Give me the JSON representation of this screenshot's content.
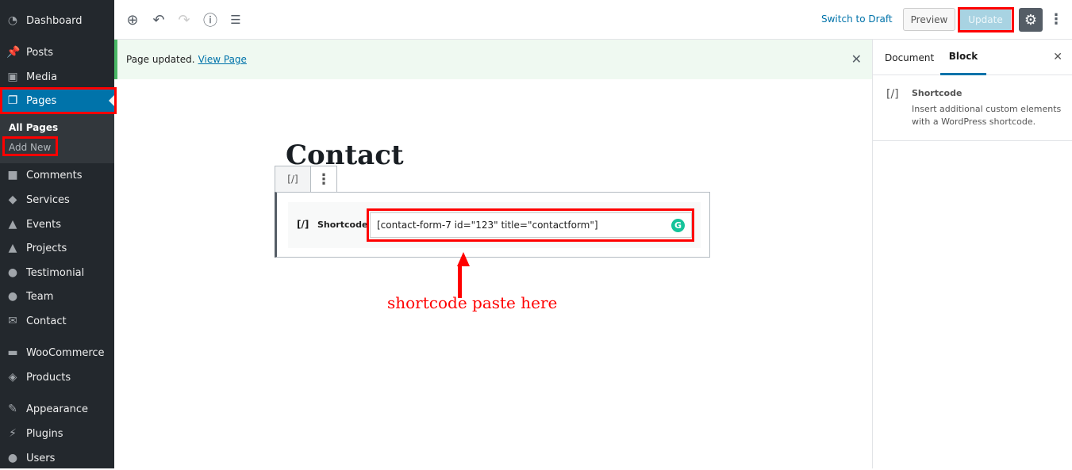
{
  "sidebar": {
    "items": [
      {
        "label": "Dashboard",
        "icon": "dashboard-icon"
      },
      {
        "label": "Posts",
        "icon": "pin-icon"
      },
      {
        "label": "Media",
        "icon": "media-icon"
      },
      {
        "label": "Pages",
        "icon": "pages-icon"
      },
      {
        "label": "Comments",
        "icon": "comment-icon"
      },
      {
        "label": "Services",
        "icon": "tag-icon"
      },
      {
        "label": "Events",
        "icon": "graduation-icon"
      },
      {
        "label": "Projects",
        "icon": "graduation-icon"
      },
      {
        "label": "Testimonial",
        "icon": "user-icon"
      },
      {
        "label": "Team",
        "icon": "user-icon"
      },
      {
        "label": "Contact",
        "icon": "mail-icon"
      },
      {
        "label": "WooCommerce",
        "icon": "woo-icon"
      },
      {
        "label": "Products",
        "icon": "box-icon"
      },
      {
        "label": "Appearance",
        "icon": "brush-icon"
      },
      {
        "label": "Plugins",
        "icon": "plug-icon"
      },
      {
        "label": "Users",
        "icon": "user-icon"
      }
    ],
    "submenu": [
      "All Pages",
      "Add New"
    ]
  },
  "toolbar": {
    "switch_draft": "Switch to Draft",
    "preview": "Preview",
    "update": "Update"
  },
  "notice": {
    "text": "Page updated.",
    "link": "View Page"
  },
  "editor": {
    "title": "Contact",
    "block_icon": "[/]",
    "block_label": "Shortcode",
    "shortcode_value": "[contact-form-7 id=\"123\" title=\"contactform\"]"
  },
  "annotation": "shortcode paste here",
  "panel": {
    "tabs": [
      "Document",
      "Block"
    ],
    "block_icon": "[/]",
    "block_name": "Shortcode",
    "block_desc": "Insert additional custom elements with a WordPress shortcode."
  },
  "colors": {
    "accent": "#0073aa",
    "annotation": "#ff0000"
  }
}
